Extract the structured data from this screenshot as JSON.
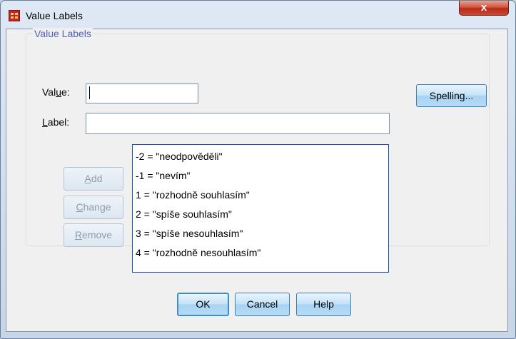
{
  "window": {
    "title": "Value Labels",
    "close_label": "x"
  },
  "group": {
    "legend": "Value Labels"
  },
  "value_field": {
    "label_pre": "Val",
    "label_key": "u",
    "label_post": "e:",
    "value": ""
  },
  "label_field": {
    "label_key": "L",
    "label_post": "abel:",
    "value": ""
  },
  "buttons": {
    "spelling": "Spelling...",
    "add_key": "A",
    "add_rest": "dd",
    "change_key": "C",
    "change_rest": "hange",
    "remove_key": "R",
    "remove_rest": "emove",
    "ok": "OK",
    "cancel": "Cancel",
    "help": "Help"
  },
  "value_labels": [
    "-2 = \"neodpověděli\"",
    "-1 = \"nevím\"",
    "1 = \"rozhodně souhlasím\"",
    "2 = \"spíše souhlasím\"",
    "3 = \"spíše nesouhlasím\"",
    "4 = \"rozhodně nesouhlasím\""
  ],
  "icons": {
    "app": "spss-data-grid-icon",
    "close": "close-icon"
  },
  "colors": {
    "legend": "#4f64b5",
    "close_button": "#c84a35",
    "list_border": "#1c4fa8"
  }
}
